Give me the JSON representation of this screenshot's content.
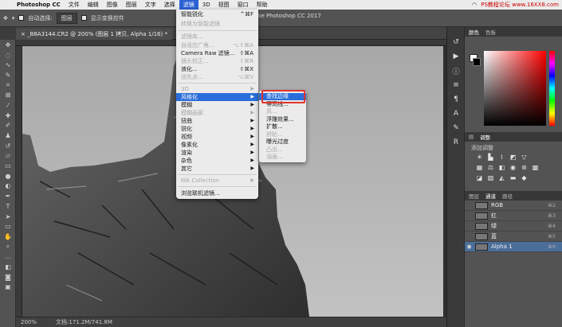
{
  "menubar": {
    "app": "Photoshop CC",
    "items": [
      "文件",
      "编辑",
      "图像",
      "图层",
      "文字",
      "选择",
      "滤镜",
      "3D",
      "视图",
      "窗口",
      "帮助"
    ],
    "active_index": 6,
    "watermark": "PS教程论坛 www.16XX8.com"
  },
  "options": {
    "auto_select": "自动选择:",
    "auto_select_value": "图层",
    "show_transform": "显示变换控件"
  },
  "document": {
    "tab": "_B8A3144.CR2 @ 200% (图层 1 拷贝, Alpha 1/16) *",
    "window_title": "be Photoshop CC 2017"
  },
  "status": {
    "zoom": "200%",
    "doc": "文档:171.2M/741.8M"
  },
  "filter_menu": [
    {
      "label": "智能锐化",
      "shortcut": "^⌘F",
      "disabled": false
    },
    {
      "label": "转换为智能滤镜",
      "disabled": true
    },
    {
      "label": "滤镜库...",
      "disabled": true
    },
    {
      "label": "自适应广角...",
      "shortcut": "⌥⇧⌘A",
      "disabled": true
    },
    {
      "label": "Camera Raw 滤镜...",
      "shortcut": "⇧⌘A",
      "disabled": false
    },
    {
      "label": "镜头校正...",
      "shortcut": "⇧⌘R",
      "disabled": true
    },
    {
      "label": "液化...",
      "shortcut": "⇧⌘X",
      "disabled": false
    },
    {
      "label": "消失点...",
      "shortcut": "⌥⌘V",
      "disabled": true
    },
    {
      "label": "3D",
      "arrow": true,
      "disabled": true
    },
    {
      "label": "风格化",
      "arrow": true,
      "highlight": true
    },
    {
      "label": "模糊",
      "arrow": true
    },
    {
      "label": "模糊画廊",
      "arrow": true,
      "disabled": true
    },
    {
      "label": "扭曲",
      "arrow": true
    },
    {
      "label": "锐化",
      "arrow": true
    },
    {
      "label": "视频",
      "arrow": true
    },
    {
      "label": "像素化",
      "arrow": true
    },
    {
      "label": "渲染",
      "arrow": true
    },
    {
      "label": "杂色",
      "arrow": true
    },
    {
      "label": "其它",
      "arrow": true
    },
    {
      "label": "Nik Collection",
      "arrow": true,
      "disabled": true
    },
    {
      "label": "浏览联机滤镜..."
    }
  ],
  "submenu": [
    {
      "label": "查找边缘",
      "highlight": true
    },
    {
      "label": "等高线..."
    },
    {
      "label": "风...",
      "disabled": true
    },
    {
      "label": "浮雕效果..."
    },
    {
      "label": "扩散..."
    },
    {
      "label": "拼贴...",
      "disabled": true
    },
    {
      "label": "曝光过度"
    },
    {
      "label": "凸出...",
      "disabled": true
    },
    {
      "label": "油画...",
      "disabled": true
    }
  ],
  "panels": {
    "color_tabs": [
      "颜色",
      "色板"
    ],
    "adjust_tab": "调整",
    "add_adjust": "添加调整",
    "layer_tabs": [
      "图层",
      "通道",
      "路径"
    ],
    "channels": [
      {
        "name": "RGB",
        "shortcut": "⌘2"
      },
      {
        "name": "红",
        "shortcut": "⌘3"
      },
      {
        "name": "绿",
        "shortcut": "⌘4"
      },
      {
        "name": "蓝",
        "shortcut": "⌘5"
      },
      {
        "name": "Alpha 1",
        "shortcut": "⌘6",
        "selected": true
      }
    ]
  },
  "colors": {
    "highlight": "#2a6edb",
    "callout": "#e2332c"
  }
}
